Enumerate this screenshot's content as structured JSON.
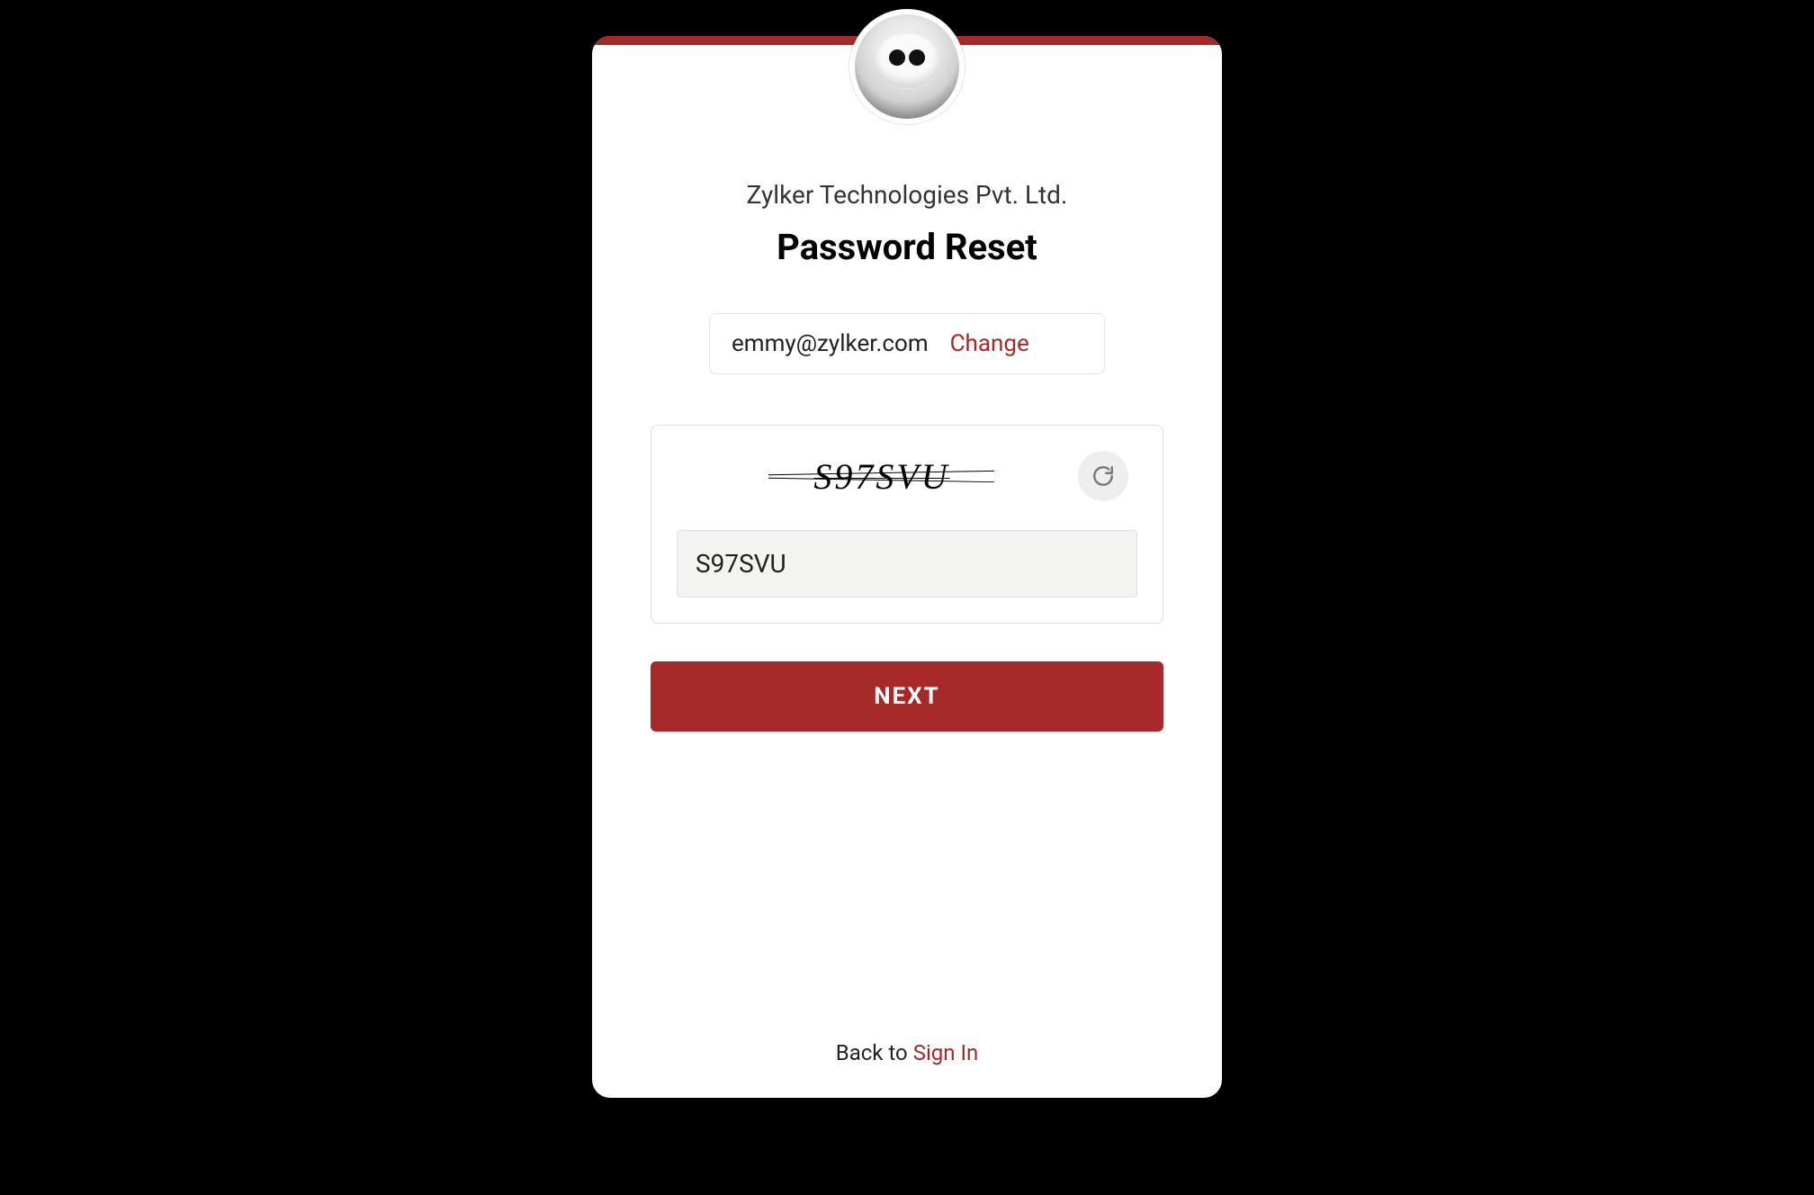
{
  "company_name": "Zylker Technologies Pvt. Ltd.",
  "page_title": "Password Reset",
  "email": {
    "value": "emmy@zylker.com",
    "change_label": "Change"
  },
  "captcha": {
    "displayed_text": "S97SVU",
    "input_value": "S97SVU"
  },
  "next_button_label": "NEXT",
  "footer": {
    "prefix": "Back to ",
    "link_label": "Sign In"
  },
  "colors": {
    "accent": "#a52929"
  }
}
